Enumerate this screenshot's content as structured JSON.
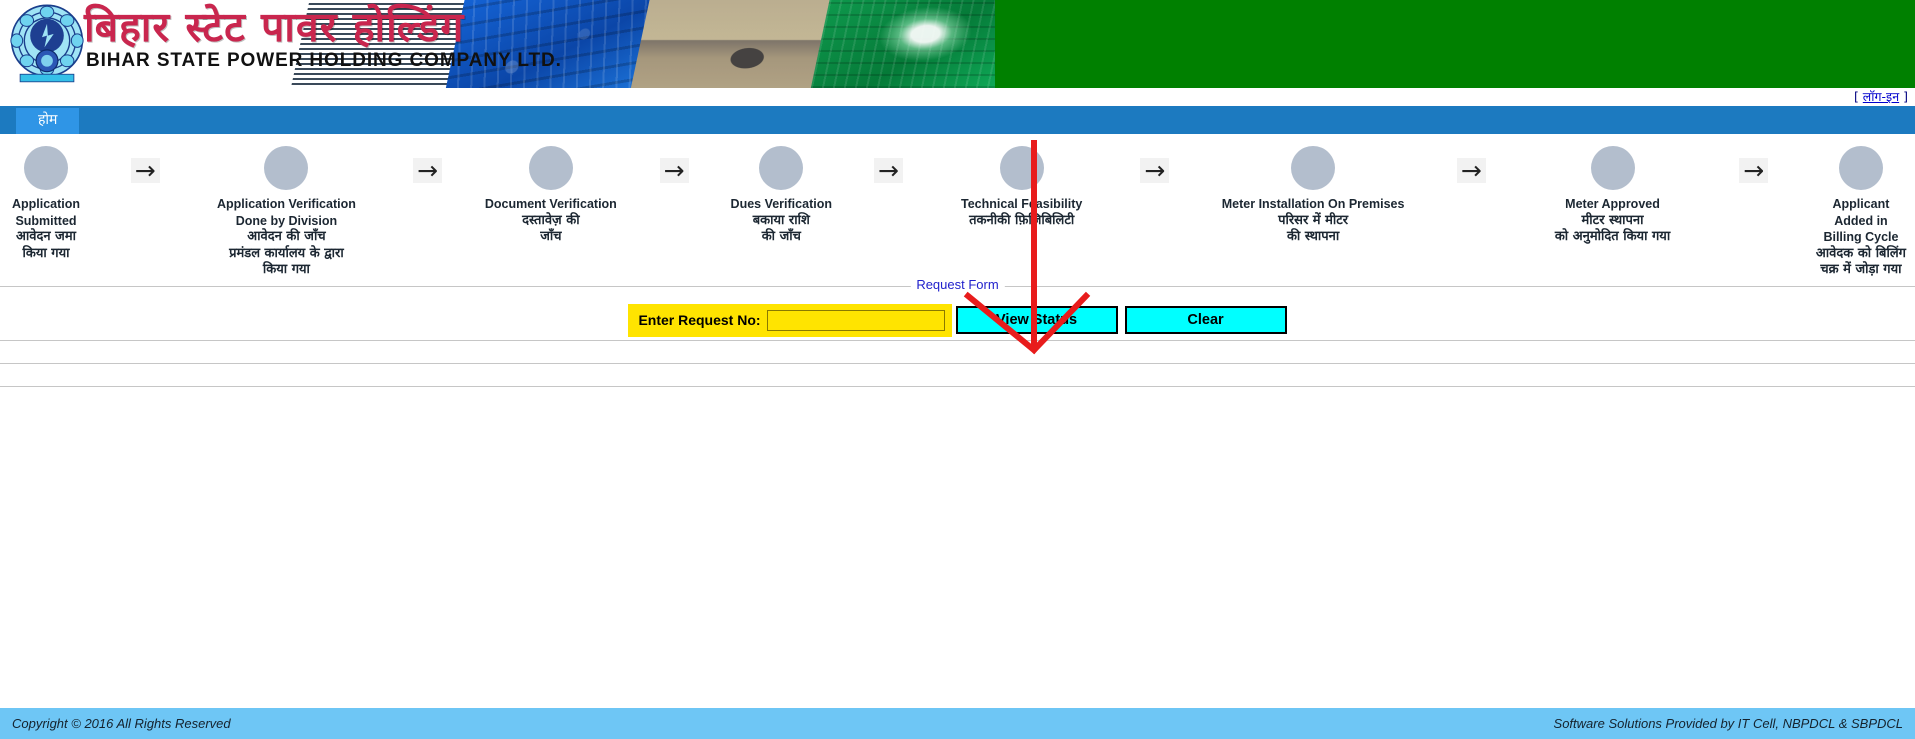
{
  "header": {
    "company_name_hi": "बिहार स्टेट पावर होल्डिंग",
    "company_name_en": "BIHAR STATE POWER HOLDING COMPANY LTD.",
    "logo_alt": "bsphcl-emblem",
    "banner_images": [
      "substation-photo",
      "office-photo",
      "lightbulb-photo"
    ]
  },
  "topbar": {
    "login_prefix": "[ ",
    "login_label": "लॉग-इन",
    "login_suffix": " ]"
  },
  "nav": {
    "tabs": [
      {
        "label": "होम"
      }
    ]
  },
  "workflow": {
    "arrow_glyph": "→",
    "steps": [
      {
        "en_lines": [
          "Application",
          "Submitted"
        ],
        "hi_lines": [
          "आवेदन जमा",
          "किया गया"
        ]
      },
      {
        "en_lines": [
          "Application Verification",
          "Done by Division"
        ],
        "hi_lines": [
          "आवेदन की जाँच",
          "प्रमंडल कार्यालय के द्वारा",
          "किया गया"
        ]
      },
      {
        "en_lines": [
          "Document Verification"
        ],
        "hi_lines": [
          "दस्तावेज़ की",
          "जाँच"
        ]
      },
      {
        "en_lines": [
          "Dues Verification"
        ],
        "hi_lines": [
          "बकाया राशि",
          "की जाँच"
        ]
      },
      {
        "en_lines": [
          "Technical Feasibility"
        ],
        "hi_lines": [
          "तकनीकी फ़िज़िबिलिटी"
        ]
      },
      {
        "en_lines": [
          "Meter Installation On Premises"
        ],
        "hi_lines": [
          "परिसर में मीटर",
          "की स्थापना"
        ]
      },
      {
        "en_lines": [
          "Meter Approved"
        ],
        "hi_lines": [
          "मीटर स्थापना",
          "को अनुमोदित किया गया"
        ]
      },
      {
        "en_lines": [
          "Applicant",
          "Added in",
          "Billing Cycle"
        ],
        "hi_lines": [
          "आवेदक को बिलिंग",
          "चक्र में जोड़ा गया"
        ]
      }
    ]
  },
  "request_form": {
    "legend": "Request Form",
    "field_label": "Enter Request No:",
    "input_value": "",
    "input_placeholder": "",
    "view_status_label": "View Status",
    "clear_label": "Clear"
  },
  "annotation": {
    "color": "#e81c1c",
    "points_to": "View Status"
  },
  "footer": {
    "left_text": "Copyright © 2016 All Rights Reserved",
    "right_text": "Software Solutions Provided by IT Cell, NBPDCL & SBPDCL"
  },
  "colors": {
    "nav_bar": "#1c7ac0",
    "nav_tab": "#2f95e6",
    "footer": "#6ec6f5",
    "button": "#00ffff",
    "field_yellow": "#ffe400",
    "header_green": "#008000",
    "step_circle": "#b3becd",
    "annotation_red": "#e81c1c",
    "legend_blue": "#2222cc"
  }
}
